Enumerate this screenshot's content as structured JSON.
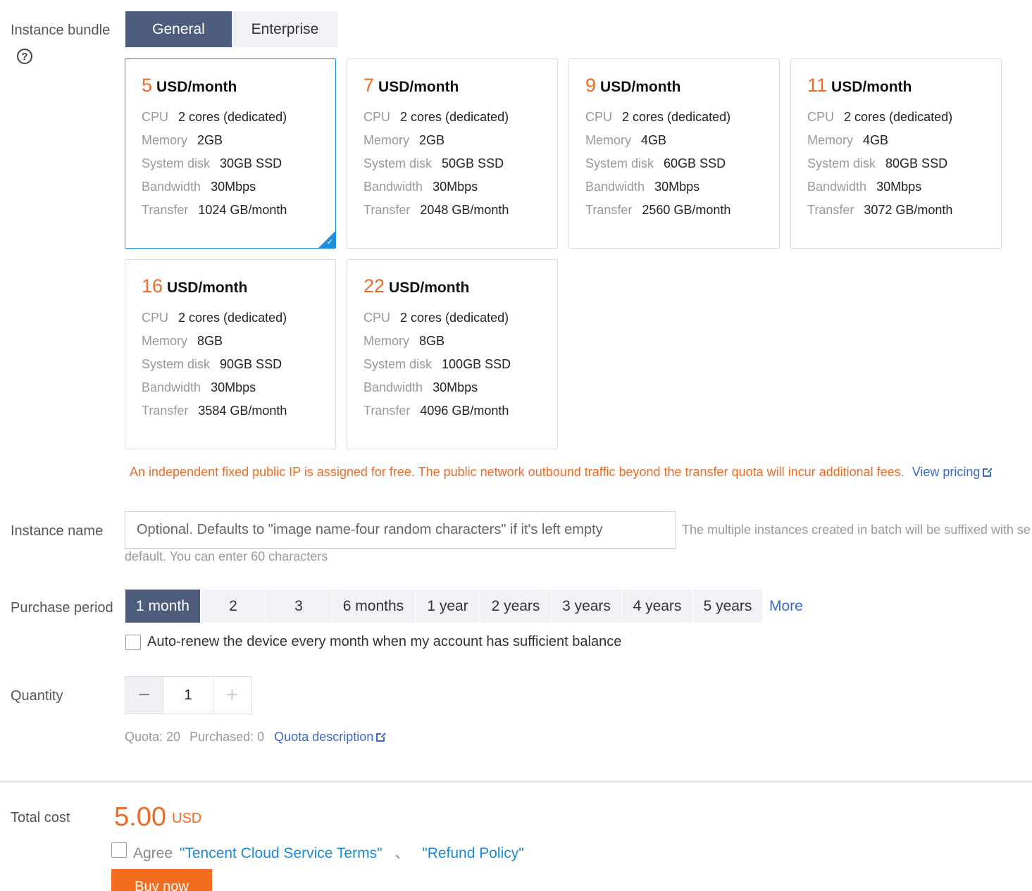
{
  "bundle": {
    "label": "Instance bundle",
    "tabs": [
      {
        "label": "General",
        "active": true
      },
      {
        "label": "Enterprise",
        "active": false
      }
    ],
    "spec_keys": {
      "cpu": "CPU",
      "memory": "Memory",
      "disk": "System disk",
      "bandwidth": "Bandwidth",
      "transfer": "Transfer"
    },
    "unit": "USD/month",
    "plans": [
      {
        "price": "5",
        "cpu": "2 cores (dedicated)",
        "memory": "2GB",
        "disk": "30GB SSD",
        "bandwidth": "30Mbps",
        "transfer": "1024 GB/month",
        "selected": true
      },
      {
        "price": "7",
        "cpu": "2 cores (dedicated)",
        "memory": "2GB",
        "disk": "50GB SSD",
        "bandwidth": "30Mbps",
        "transfer": "2048 GB/month",
        "selected": false
      },
      {
        "price": "9",
        "cpu": "2 cores (dedicated)",
        "memory": "4GB",
        "disk": "60GB SSD",
        "bandwidth": "30Mbps",
        "transfer": "2560 GB/month",
        "selected": false
      },
      {
        "price": "11",
        "cpu": "2 cores (dedicated)",
        "memory": "4GB",
        "disk": "80GB SSD",
        "bandwidth": "30Mbps",
        "transfer": "3072 GB/month",
        "selected": false
      },
      {
        "price": "16",
        "cpu": "2 cores (dedicated)",
        "memory": "8GB",
        "disk": "90GB SSD",
        "bandwidth": "30Mbps",
        "transfer": "3584 GB/month",
        "selected": false
      },
      {
        "price": "22",
        "cpu": "2 cores (dedicated)",
        "memory": "8GB",
        "disk": "100GB SSD",
        "bandwidth": "30Mbps",
        "transfer": "4096 GB/month",
        "selected": false
      }
    ],
    "notice": "An independent fixed public IP is assigned for free. The public network outbound traffic beyond the transfer quota will incur additional fees.",
    "view_pricing": "View pricing"
  },
  "instance_name": {
    "label": "Instance name",
    "placeholder": "Optional. Defaults to \"image name-four random characters\" if it's left empty",
    "value": "",
    "hint_line1": "The multiple instances created in batch will be suffixed with se",
    "hint_line2": "default. You can enter 60 characters"
  },
  "purchase_period": {
    "label": "Purchase period",
    "options": [
      {
        "label": "1 month",
        "active": true
      },
      {
        "label": "2",
        "active": false
      },
      {
        "label": "3",
        "active": false
      },
      {
        "label": "6 months",
        "active": false
      },
      {
        "label": "1 year",
        "active": false
      },
      {
        "label": "2 years",
        "active": false
      },
      {
        "label": "3 years",
        "active": false
      },
      {
        "label": "4 years",
        "active": false
      },
      {
        "label": "5 years",
        "active": false
      }
    ],
    "more": "More",
    "auto_renew": "Auto-renew the device every month when my account has sufficient balance",
    "auto_renew_checked": false
  },
  "quantity": {
    "label": "Quantity",
    "value": "1",
    "minus": "−",
    "plus": "+",
    "quota": "Quota: 20",
    "purchased": "Purchased: 0",
    "quota_link": "Quota description"
  },
  "total": {
    "label": "Total cost",
    "amount": "5.00",
    "currency": "USD",
    "agree": "Agree",
    "terms": "\"Tencent Cloud Service Terms\"",
    "separator": "、",
    "refund": "\"Refund Policy\"",
    "agree_checked": false,
    "buy_label": "Buy now"
  },
  "colors": {
    "accent_orange": "#ef6a24",
    "active_tab": "#4e5d7e",
    "link_blue": "#3a69c9",
    "selected_border": "#1e8fd8"
  }
}
